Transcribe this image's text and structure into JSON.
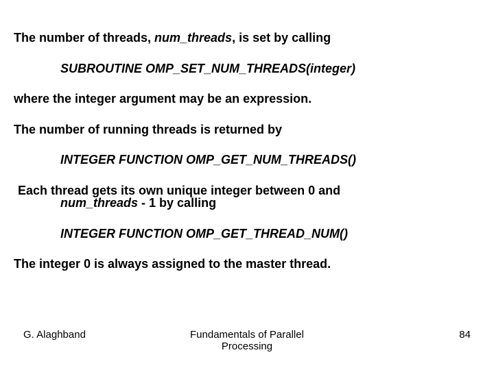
{
  "body": {
    "p1_a": "The number of threads, ",
    "p1_b": "num_threads",
    "p1_c": ", is set by calling",
    "p2": "SUBROUTINE OMP_SET_NUM_THREADS(integer)",
    "p3": "where the integer argument may be an expression.",
    "p4": "The number of running threads is returned by",
    "p5": "INTEGER FUNCTION OMP_GET_NUM_THREADS()",
    "p6_a": "Each thread gets its own unique integer between 0 and",
    "p6_b": "num_threads",
    "p6_c": " - 1 by calling",
    "p7": "INTEGER FUNCTION OMP_GET_THREAD_NUM()",
    "p8": "The integer 0 is always assigned to the master thread."
  },
  "footer": {
    "author": "G. Alaghband",
    "title_l1": "Fundamentals of Parallel",
    "title_l2": "Processing",
    "page": "84"
  }
}
